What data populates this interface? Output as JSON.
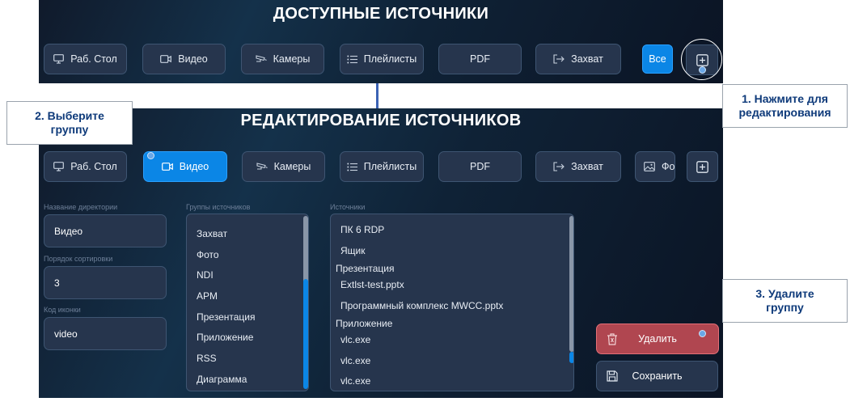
{
  "top_panel": {
    "title": "ДОСТУПНЫЕ ИСТОЧНИКИ",
    "chips": [
      {
        "label": "Раб. Стол",
        "icon": "monitor-icon"
      },
      {
        "label": "Видео",
        "icon": "video-camera-icon"
      },
      {
        "label": "Камеры",
        "icon": "cctv-camera-icon"
      },
      {
        "label": "Плейлисты",
        "icon": "list-icon"
      },
      {
        "label": "PDF",
        "icon": ""
      },
      {
        "label": "Захват",
        "icon": "capture-arrow-icon"
      }
    ],
    "all_label": "Все",
    "edit_icon": "plus-square-icon"
  },
  "bottom_panel": {
    "title": "РЕДАКТИРОВАНИЕ ИСТОЧНИКОВ",
    "chips": [
      {
        "label": "Раб. Стол",
        "icon": "monitor-icon"
      },
      {
        "label": "Видео",
        "icon": "video-camera-icon",
        "active": true
      },
      {
        "label": "Камеры",
        "icon": "cctv-camera-icon"
      },
      {
        "label": "Плейлисты",
        "icon": "list-icon"
      },
      {
        "label": "PDF",
        "icon": ""
      },
      {
        "label": "Захват",
        "icon": "capture-arrow-icon"
      },
      {
        "label": "Фо",
        "icon": "image-icon"
      }
    ],
    "add_icon": "plus-square-icon",
    "form": {
      "name_label": "Название директории",
      "name_value": "Видео",
      "sort_label": "Порядок сортировки",
      "sort_value": "3",
      "icon_label": "Код иконки",
      "icon_value": "video"
    },
    "groups": {
      "label": "Группы источников",
      "items": [
        "Захват",
        "Фото",
        "NDI",
        "APM",
        "Презентация",
        "Приложение",
        "RSS",
        "Диаграмма"
      ]
    },
    "sources": {
      "label": "Источники",
      "lines": [
        {
          "kind": "item",
          "text": "ПК 6 RDP"
        },
        {
          "kind": "item",
          "text": "Ящик"
        },
        {
          "kind": "header",
          "text": "Презентация"
        },
        {
          "kind": "item",
          "text": "Extlst-test.pptx"
        },
        {
          "kind": "item",
          "text": "Программный комплекс MWCC.pptx"
        },
        {
          "kind": "header",
          "text": "Приложение"
        },
        {
          "kind": "item",
          "text": "vlc.exe"
        },
        {
          "kind": "item",
          "text": "vlc.exe"
        },
        {
          "kind": "item",
          "text": "vlc.exe"
        }
      ]
    },
    "delete_label": "Удалить",
    "save_label": "Сохранить"
  },
  "callouts": {
    "step1": "1. Нажмите для редактирования",
    "step2": "2. Выберите группу",
    "step3": "3. Удалите группу"
  },
  "colors": {
    "accent": "#0b86e6",
    "panel_bg": "#14314a",
    "chip_bg": "#26354d",
    "delete_bg": "#b04650",
    "callout_text": "#0e3a7a"
  }
}
